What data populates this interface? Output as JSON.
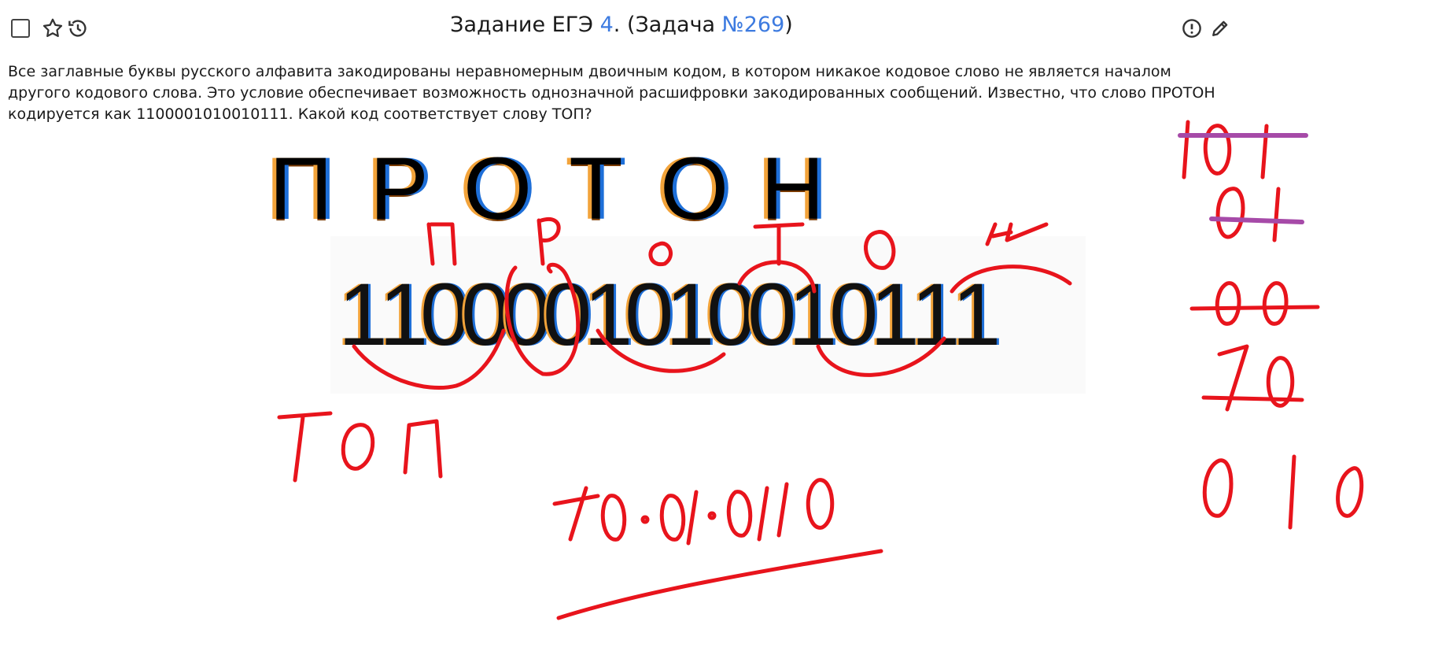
{
  "header": {
    "title_prefix": "Задание ЕГЭ ",
    "task_type_number": "4",
    "title_middle": ". (Задача ",
    "task_number": "№269",
    "title_suffix": ")"
  },
  "task": {
    "text": "Все заглавные буквы русского алфавита закодированы неравномерным двоичным кодом, в котором никакое кодовое слово не является началом другого кодового слова. Это условие обеспечивает возможность однозначной расшифровки закодированных сообщений. Известно, что слово ПРОТОН кодируется как 1100001010010111. Какой код соответствует слову ТОП?"
  },
  "figure": {
    "word_letters": [
      "П",
      "Р",
      "О",
      "Т",
      "О",
      "Н"
    ],
    "code_digits": [
      "1",
      "1",
      "0",
      "0",
      "0",
      "0",
      "1",
      "0",
      "1",
      "0",
      "0",
      "1",
      "0",
      "1",
      "1",
      "1"
    ]
  },
  "annotations": {
    "letters_above": [
      "п",
      "Р",
      "о",
      "т",
      "о",
      "н"
    ],
    "answer_word": "ТОП",
    "answer_code": "10·01·0110",
    "side_codes": [
      "101",
      "01",
      "00",
      "10",
      "010"
    ]
  },
  "colors": {
    "link": "#3d7be0",
    "ink_red": "#e8141c",
    "ink_purple": "#a64aa8"
  },
  "icons": [
    "star-icon",
    "history-icon",
    "report-icon",
    "edit-icon"
  ]
}
